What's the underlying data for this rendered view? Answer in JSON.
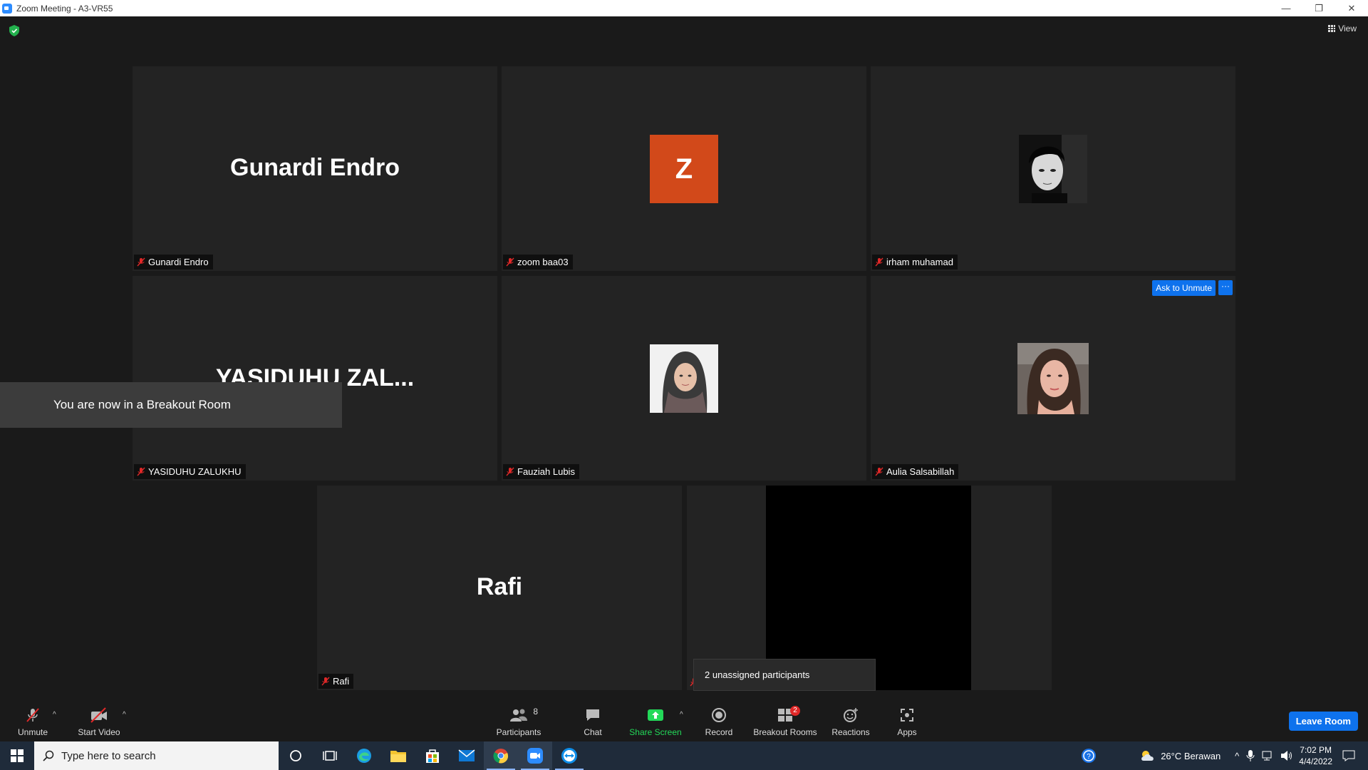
{
  "window": {
    "title": "Zoom Meeting - A3-VR55",
    "controls": [
      "minimize",
      "restore",
      "close"
    ]
  },
  "top_bar": {
    "view_label": "View"
  },
  "tiles": [
    {
      "big_name": "Gunardi Endro",
      "label": "Gunardi Endro"
    },
    {
      "avatar_letter": "Z",
      "avatar_color": "#d2491a",
      "label": "zoom baa03"
    },
    {
      "label": "irham muhamad"
    },
    {
      "big_name": "YASIDUHU  ZAL...",
      "label": "YASIDUHU ZALUKHU"
    },
    {
      "label": "Fauziah Lubis"
    },
    {
      "label": "Aulia Salsabillah",
      "ask_unmute": "Ask to Unmute",
      "more": "···"
    },
    {
      "big_name": "Rafi",
      "label": "Rafi"
    }
  ],
  "toast": "You are now in a Breakout Room",
  "unassigned_tooltip": "2 unassigned participants",
  "toolbar": {
    "unmute": "Unmute",
    "start_video": "Start Video",
    "participants": "Participants",
    "participants_count": "8",
    "chat": "Chat",
    "share_screen": "Share Screen",
    "record": "Record",
    "breakout_rooms": "Breakout Rooms",
    "breakout_badge": "2",
    "reactions": "Reactions",
    "apps": "Apps",
    "leave": "Leave Room"
  },
  "taskbar": {
    "search_placeholder": "Type here to search",
    "weather": "26°C  Berawan",
    "time": "7:02 PM",
    "date": "4/4/2022"
  },
  "colors": {
    "accent": "#0e72ed",
    "share_green": "#23d959",
    "avatar_orange": "#d2491a",
    "badge_red": "#e02828"
  }
}
